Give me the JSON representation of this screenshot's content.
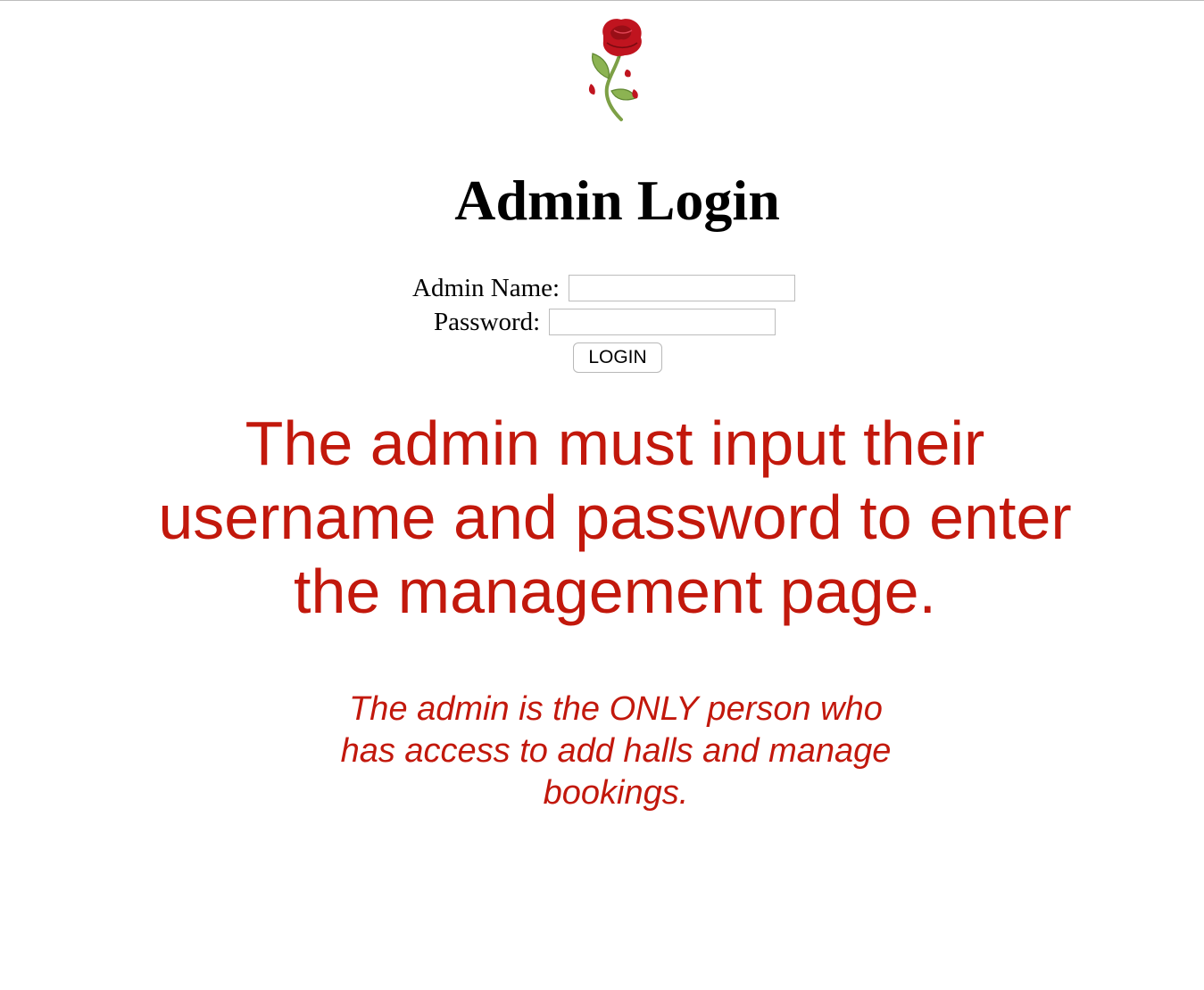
{
  "header": {
    "logo_icon": "rose-icon",
    "title": "Admin Login"
  },
  "form": {
    "admin_name_label": "Admin Name:",
    "admin_name_value": "",
    "password_label": "Password:",
    "password_value": "",
    "login_label": "LOGIN"
  },
  "messages": {
    "main": "The admin must input their username and password to enter the management page.",
    "sub": "The admin is the ONLY person who has access to add halls and manage bookings."
  },
  "colors": {
    "message_red": "#c2180c",
    "rose_red": "#c0141f",
    "stem_green": "#6f9a3b"
  }
}
